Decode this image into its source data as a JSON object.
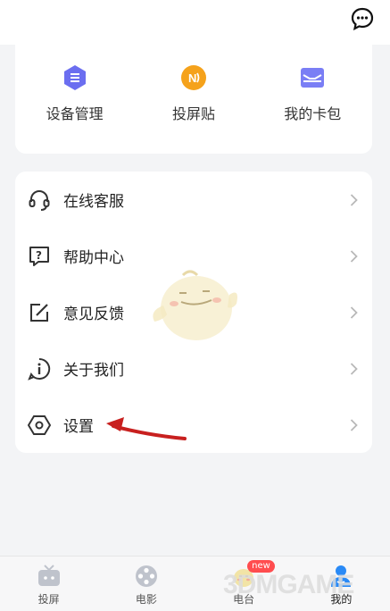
{
  "header": {
    "chat_icon": "chat-bubble-icon"
  },
  "quick_actions": [
    {
      "label": "设备管理",
      "icon": "device-hexagon-icon",
      "color": "#6b6ef0"
    },
    {
      "label": "投屏贴",
      "icon": "cast-sticker-icon",
      "color": "#f5a21b"
    },
    {
      "label": "我的卡包",
      "icon": "card-wallet-icon",
      "color": "#7a7ef5"
    }
  ],
  "menu": [
    {
      "label": "在线客服",
      "icon": "headset-icon"
    },
    {
      "label": "帮助中心",
      "icon": "help-question-icon"
    },
    {
      "label": "意见反馈",
      "icon": "edit-feedback-icon"
    },
    {
      "label": "关于我们",
      "icon": "info-icon"
    },
    {
      "label": "设置",
      "icon": "settings-hexagon-icon"
    }
  ],
  "tabs": [
    {
      "label": "投屏",
      "icon": "tv-icon"
    },
    {
      "label": "电影",
      "icon": "film-reel-icon"
    },
    {
      "label": "电台",
      "icon": "radio-mascot-icon",
      "badge": "new"
    },
    {
      "label": "我的",
      "icon": "profile-icon",
      "active": true
    }
  ],
  "watermark": "3DMGAME",
  "colors": {
    "accent": "#6b6ef0",
    "arrow": "#c8201f",
    "badge": "#ff4d4f"
  }
}
